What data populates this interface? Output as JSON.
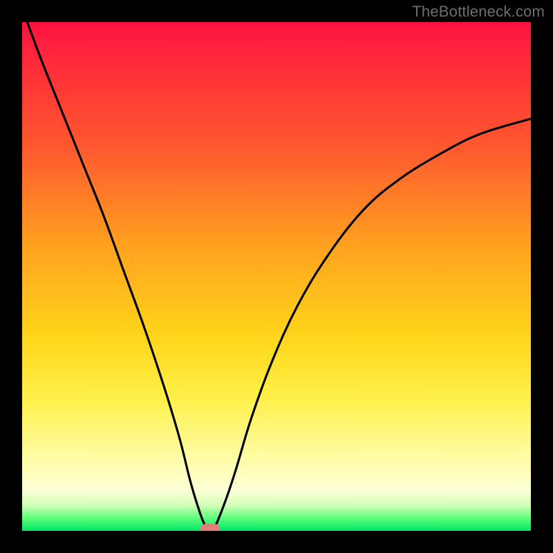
{
  "watermark": "TheBottleneck.com",
  "colors": {
    "frame": "#000000",
    "curve": "#000000",
    "marker": "#e47f7a"
  },
  "chart_data": {
    "type": "line",
    "title": "",
    "xlabel": "",
    "ylabel": "",
    "xlim": [
      0,
      100
    ],
    "ylim": [
      0,
      100
    ],
    "grid": false,
    "curve_points": [
      {
        "x": 1,
        "y": 100
      },
      {
        "x": 4,
        "y": 92
      },
      {
        "x": 8,
        "y": 82
      },
      {
        "x": 12,
        "y": 72
      },
      {
        "x": 16,
        "y": 62
      },
      {
        "x": 20,
        "y": 51
      },
      {
        "x": 24,
        "y": 40
      },
      {
        "x": 28,
        "y": 28
      },
      {
        "x": 31,
        "y": 18
      },
      {
        "x": 33,
        "y": 10
      },
      {
        "x": 34.8,
        "y": 4
      },
      {
        "x": 36,
        "y": 1
      },
      {
        "x": 37,
        "y": 0
      },
      {
        "x": 38,
        "y": 1
      },
      {
        "x": 40,
        "y": 6
      },
      {
        "x": 42,
        "y": 12
      },
      {
        "x": 45,
        "y": 22
      },
      {
        "x": 49,
        "y": 33
      },
      {
        "x": 54,
        "y": 44
      },
      {
        "x": 60,
        "y": 54
      },
      {
        "x": 67,
        "y": 63
      },
      {
        "x": 74,
        "y": 69
      },
      {
        "x": 82,
        "y": 74
      },
      {
        "x": 90,
        "y": 78
      },
      {
        "x": 100,
        "y": 81
      }
    ],
    "marker": {
      "x": 37,
      "y": 0
    }
  }
}
